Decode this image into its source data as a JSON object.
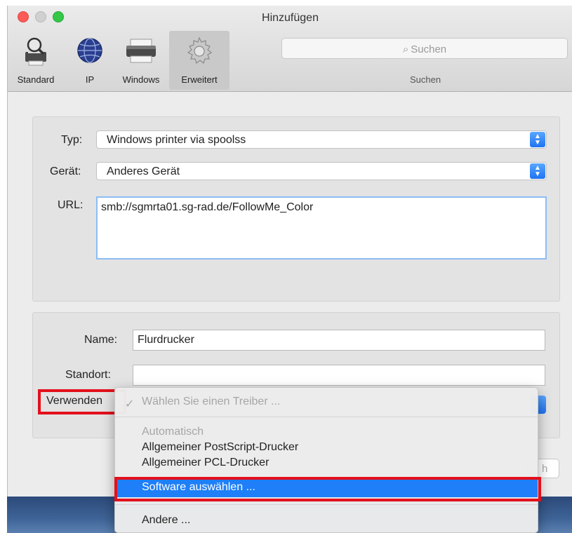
{
  "window": {
    "title": "Hinzufügen"
  },
  "toolbar": {
    "standard_label": "Standard",
    "ip_label": "IP",
    "windows_label": "Windows",
    "erweitert_label": "Erweitert",
    "search_placeholder": "Suchen",
    "search_label": "Suchen"
  },
  "form_top": {
    "typ_label": "Typ:",
    "typ_value": "Windows printer via spoolss",
    "geraet_label": "Gerät:",
    "geraet_value": "Anderes Gerät",
    "url_label": "URL:",
    "url_value": "smb://sgmrta01.sg-rad.de/FollowMe_Color"
  },
  "form_bottom": {
    "name_label": "Name:",
    "name_value": "Flurdrucker",
    "standort_label": "Standort:",
    "standort_value": "",
    "verwenden_label": "Verwenden"
  },
  "dropdown": {
    "header": "Wählen Sie einen Treiber ...",
    "items": [
      {
        "label": "Automatisch",
        "state": "disabled"
      },
      {
        "label": "Allgemeiner PostScript-Drucker",
        "state": "enabled"
      },
      {
        "label": "Allgemeiner PCL-Drucker",
        "state": "enabled"
      },
      {
        "label": "Software auswählen ...",
        "state": "selected"
      },
      {
        "label": "Andere ...",
        "state": "enabled"
      }
    ]
  },
  "partial_button_text": "h",
  "colors": {
    "selection": "#1e7ff8",
    "annotation_red": "#e3101c",
    "stepper_blue": "#1f73f1"
  }
}
